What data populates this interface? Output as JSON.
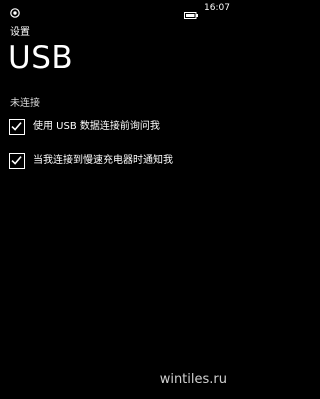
{
  "status_bar": {
    "time": "16:07",
    "left_icon": "notification-icon",
    "battery_icon": "battery-icon"
  },
  "header": {
    "app_title": "设置",
    "page_title": "USB"
  },
  "connection": {
    "status_text": "未连接"
  },
  "options": [
    {
      "label": "使用 USB 数据连接前询问我",
      "checked": true
    },
    {
      "label": "当我连接到慢速充电器时通知我",
      "checked": true
    }
  ],
  "watermark": "wintiles.ru",
  "colors": {
    "background": "#000000",
    "text": "#ffffff",
    "checkbox_border": "#ffffff"
  }
}
